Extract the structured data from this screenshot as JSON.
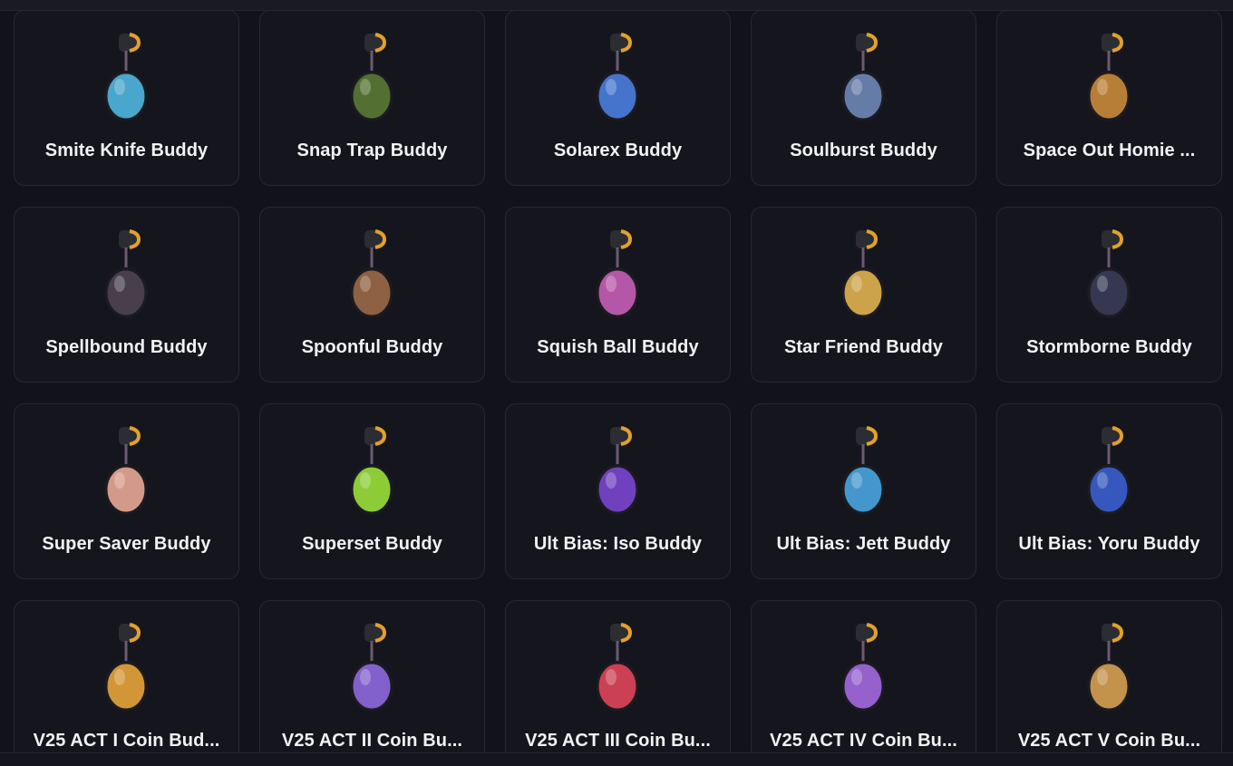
{
  "buddies": [
    {
      "name": "Smite Knife Buddy",
      "icon": "smite-knife-buddy-icon",
      "color": "#4fb6e0"
    },
    {
      "name": "Snap Trap Buddy",
      "icon": "snap-trap-buddy-icon",
      "color": "#5a7a35"
    },
    {
      "name": "Solarex Buddy",
      "icon": "solarex-buddy-icon",
      "color": "#4a7fe0"
    },
    {
      "name": "Soulburst Buddy",
      "icon": "soulburst-buddy-icon",
      "color": "#6f88b8"
    },
    {
      "name": "Space Out Homie ...",
      "icon": "space-out-homie-buddy-icon",
      "color": "#c98a3a"
    },
    {
      "name": "Spellbound Buddy",
      "icon": "spellbound-buddy-icon",
      "color": "#4e4450"
    },
    {
      "name": "Spoonful Buddy",
      "icon": "spoonful-buddy-icon",
      "color": "#9a6a45"
    },
    {
      "name": "Squish Ball Buddy",
      "icon": "squish-ball-buddy-icon",
      "color": "#c75fb8"
    },
    {
      "name": "Star Friend Buddy",
      "icon": "star-friend-buddy-icon",
      "color": "#e0b350"
    },
    {
      "name": "Stormborne Buddy",
      "icon": "stormborne-buddy-icon",
      "color": "#3a3c58"
    },
    {
      "name": "Super Saver Buddy",
      "icon": "super-saver-buddy-icon",
      "color": "#e9a995"
    },
    {
      "name": "Superset Buddy",
      "icon": "superset-buddy-icon",
      "color": "#9be03a"
    },
    {
      "name": "Ult Bias: Iso Buddy",
      "icon": "ult-bias-iso-buddy-icon",
      "color": "#7a46d0"
    },
    {
      "name": "Ult Bias: Jett Buddy",
      "icon": "ult-bias-jett-buddy-icon",
      "color": "#4aa6e0"
    },
    {
      "name": "Ult Bias: Yoru Buddy",
      "icon": "ult-bias-yoru-buddy-icon",
      "color": "#3a5fd0"
    },
    {
      "name": "V25 ACT I Coin Bud...",
      "icon": "v25-act-i-coin-buddy-icon",
      "color": "#e8a43a"
    },
    {
      "name": "V25 ACT II Coin Bu...",
      "icon": "v25-act-ii-coin-buddy-icon",
      "color": "#8e6ae0"
    },
    {
      "name": "V25 ACT III Coin Bu...",
      "icon": "v25-act-iii-coin-buddy-icon",
      "color": "#e0455a"
    },
    {
      "name": "V25 ACT IV Coin Bu...",
      "icon": "v25-act-iv-coin-buddy-icon",
      "color": "#a46ae0"
    },
    {
      "name": "V25 ACT V Coin Bu...",
      "icon": "v25-act-v-coin-buddy-icon",
      "color": "#d6a050"
    }
  ]
}
